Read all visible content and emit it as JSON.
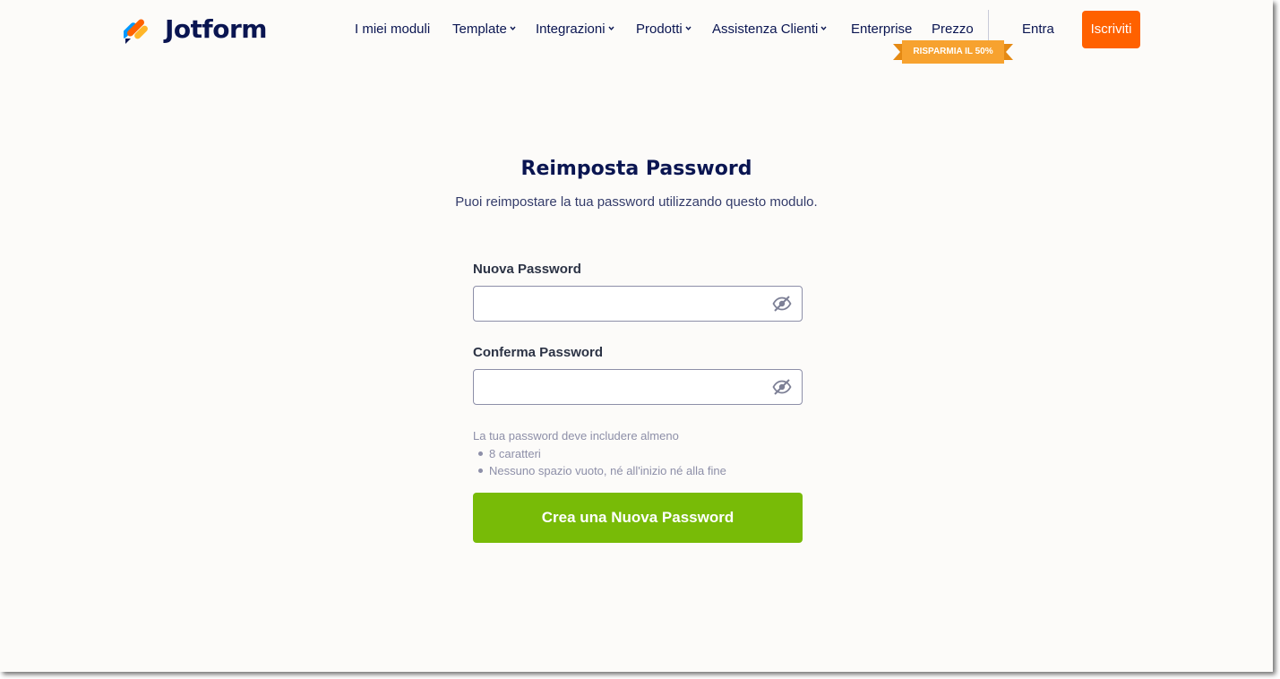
{
  "brand": {
    "name": "Jotform"
  },
  "nav": {
    "my_forms": "I miei moduli",
    "templates": "Template",
    "integrations": "Integrazioni",
    "products": "Prodotti",
    "support": "Assistenza Clienti",
    "enterprise": "Enterprise",
    "pricing": "Prezzo",
    "pricing_badge": "RISPARMIA IL 50%",
    "login": "Entra",
    "signup": "Iscriviti"
  },
  "form": {
    "title": "Reimposta Password",
    "subtitle": "Puoi reimpostare la tua password utilizzando questo modulo.",
    "new_password_label": "Nuova Password",
    "new_password_value": "",
    "confirm_password_label": "Conferma Password",
    "confirm_password_value": "",
    "requirements_intro": "La tua password deve includere almeno",
    "requirements": [
      "8 caratteri",
      "Nessuno spazio vuoto, né all'inizio né alla fine"
    ],
    "submit_label": "Crea una Nuova Password"
  },
  "icons": {
    "logo": "jotform-logo-icon",
    "toggle_visibility": "eye-slash-icon",
    "dropdown": "chevron-down-icon"
  },
  "colors": {
    "navy": "#0a1551",
    "signup": "#ff6100",
    "badge": "#f7a22f",
    "submit": "#78bb07",
    "background": "#fcfbf9"
  }
}
